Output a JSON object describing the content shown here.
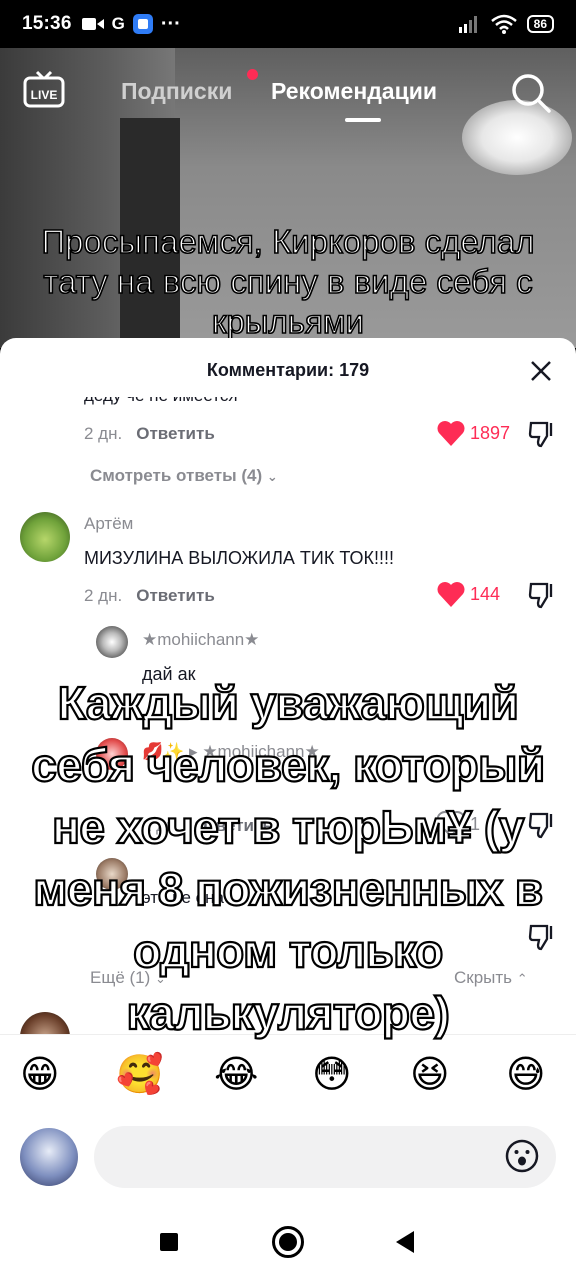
{
  "status_bar": {
    "time": "15:36",
    "left_icons": [
      "video-call-icon",
      "google-icon",
      "app-icon",
      "more-dots-icon"
    ],
    "dots": "···",
    "g_letter": "G",
    "battery": "86"
  },
  "top_nav": {
    "live_label": "LIVE",
    "tab_subscriptions": "Подписки",
    "tab_recommendations": "Рекомендации",
    "notification_color": "#fe2c55"
  },
  "video": {
    "caption": "Просыпаемся, Киркоров сделал тату на всю спину в виде себя с крыльями"
  },
  "comments": {
    "title": "Комментарии: 179",
    "partial_text": "деду чё не имеется",
    "items": [
      {
        "time": "2 дн.",
        "reply_label": "Ответить",
        "likes": "1897",
        "liked": true,
        "view_replies": "Смотреть ответы (4)"
      },
      {
        "username": "Артём",
        "text": "МИЗУЛИНА ВЫЛОЖИЛА ТИК ТОК!!!!",
        "time": "2 дн.",
        "reply_label": "Ответить",
        "likes": "144",
        "liked": true
      }
    ],
    "replies": [
      {
        "username": "★mohiichann★",
        "text": "дай ак"
      },
      {
        "username": "💋✨ ▸ ★mohiichann★",
        "time": "1 дн.",
        "reply_label": "Ответить",
        "likes": "1",
        "liked": false
      },
      {
        "text": "это не она"
      }
    ],
    "more_label": "Ещё (1)",
    "hide_label": "Скрыть"
  },
  "emoji_bar": [
    "😁",
    "🥰",
    "😂",
    "😳",
    "😆",
    "😅"
  ],
  "overlay_caption": "Каждый уважающий себя человек, который не хочет в тюрЬм¥  (у меня 8 пожизненных в одном только калькуляторе)",
  "accent_color": "#fe2c55"
}
